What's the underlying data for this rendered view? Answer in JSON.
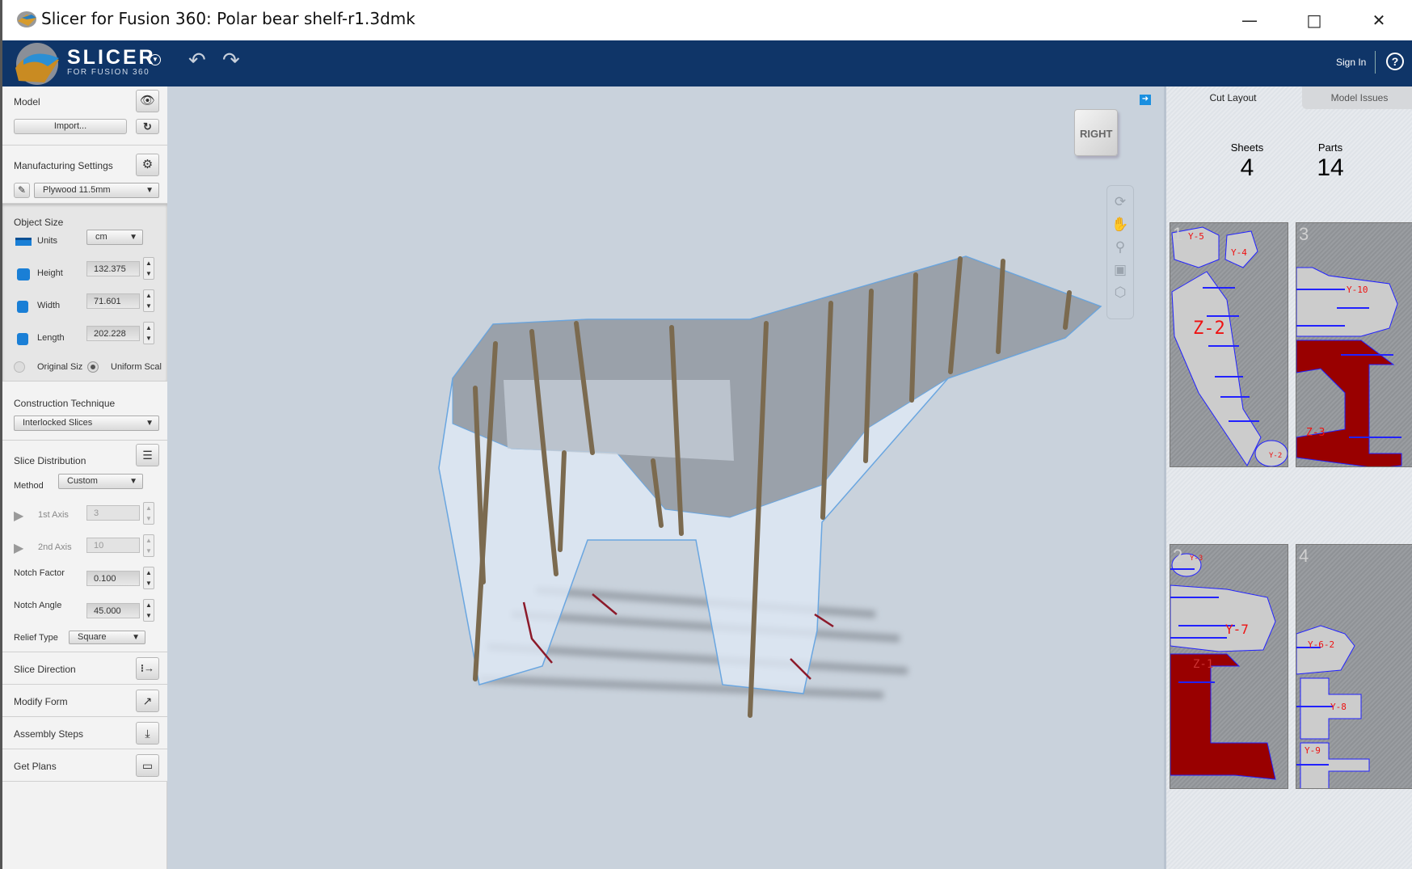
{
  "window": {
    "title": "Slicer for Fusion 360: Polar bear shelf-r1.3dmk",
    "controls": [
      "minimize",
      "maximize",
      "close"
    ]
  },
  "header": {
    "logo_word": "SLICER",
    "logo_sub": "FOR FUSION 360",
    "sign_in": "Sign In",
    "help": "?",
    "accent": "#0f3568"
  },
  "left": {
    "model": {
      "label": "Model",
      "import": "Import..."
    },
    "manufacturing": {
      "label": "Manufacturing Settings",
      "material": "Plywood 11.5mm"
    },
    "object_size": {
      "label": "Object Size",
      "units_label": "Units",
      "units": "cm",
      "height_label": "Height",
      "height": "132.375",
      "width_label": "Width",
      "width": "71.601",
      "length_label": "Length",
      "length": "202.228",
      "original": "Original Siz",
      "uniform": "Uniform Scal"
    },
    "construction": {
      "label": "Construction Technique",
      "technique": "Interlocked Slices"
    },
    "slice_distribution": {
      "label": "Slice Distribution",
      "method_label": "Method",
      "method": "Custom",
      "axis1_label": "1st Axis",
      "axis1": "3",
      "axis2_label": "2nd Axis",
      "axis2": "10",
      "notch_factor_label": "Notch Factor",
      "notch_factor": "0.100",
      "notch_angle_label": "Notch Angle",
      "notch_angle": "45.000",
      "relief_label": "Relief Type",
      "relief": "Square"
    },
    "slice_direction": "Slice Direction",
    "modify_form": "Modify Form",
    "assembly_steps": "Assembly Steps",
    "get_plans": "Get Plans"
  },
  "viewport": {
    "view_cube": "RIGHT",
    "tools": [
      "orbit-icon",
      "pan-icon",
      "zoom-icon",
      "fit-icon",
      "home-view-icon"
    ]
  },
  "right": {
    "tabs": [
      "Cut Layout",
      "Model Issues"
    ],
    "active_tab": "Cut Layout",
    "sheets_label": "Sheets",
    "sheets": "4",
    "parts_label": "Parts",
    "parts": "14",
    "sheet_list": [
      {
        "number": "1",
        "parts": [
          "Y-5",
          "Y-4",
          "Z-2",
          "Y-2"
        ]
      },
      {
        "number": "3",
        "parts": [
          "Y-10",
          "Z-3"
        ]
      },
      {
        "number": "2",
        "parts": [
          "Y-3",
          "Y-7",
          "Z-1"
        ]
      },
      {
        "number": "4",
        "parts": [
          "Y-6-2",
          "Y-8",
          "Y-9"
        ]
      }
    ]
  }
}
